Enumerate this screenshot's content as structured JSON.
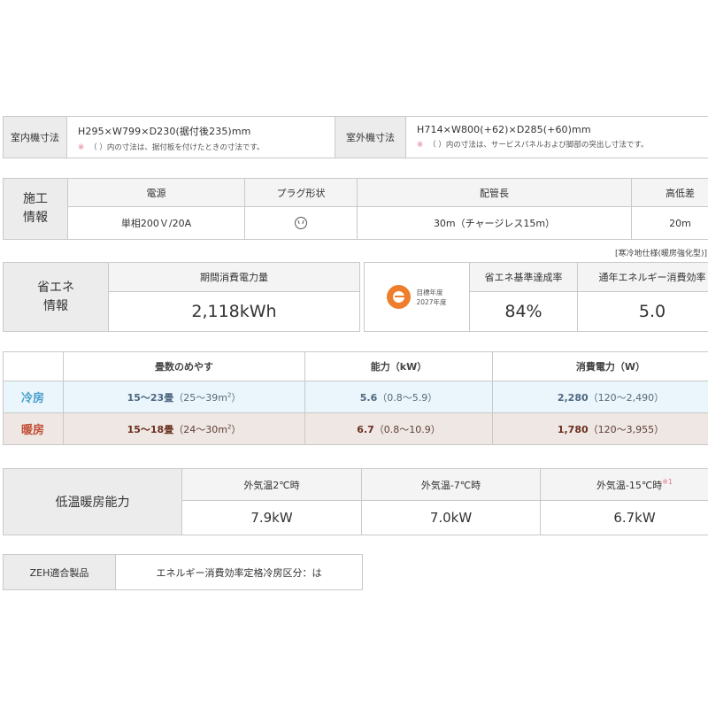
{
  "dimensions": {
    "indoor_label": "室内機寸法",
    "indoor_value": "H295×W799×D230(据付後235)mm",
    "indoor_note_mark": "※",
    "indoor_note": "（ ）内の寸法は、据付板を付けたときの寸法です。",
    "outdoor_label": "室外機寸法",
    "outdoor_value": "H714×W800(+62)×D285(+60)mm",
    "outdoor_note_mark": "※",
    "outdoor_note": "（ ）内の寸法は、サービスパネルおよび脚部の突出し寸法です。"
  },
  "construction": {
    "label_line1": "施工",
    "label_line2": "情報",
    "headers": [
      "電源",
      "プラグ形状",
      "配管長",
      "高低差"
    ],
    "power": "単相200Ｖ/20A",
    "plug_icon": "plug-outlet-icon",
    "pipe_length": "30m（チャージレス15m）",
    "height_diff": "20m"
  },
  "cold_region_note": "[寒冷地仕様(暖房強化型)]",
  "energy": {
    "label_line1": "省エネ",
    "label_line2": "情報",
    "annual_power_label": "期間消費電力量",
    "annual_power_value": "2,118kWh",
    "target_line1": "目標年度",
    "target_line2": "2027年度",
    "achievement_label": "省エネ基準達成率",
    "achievement_value": "84%",
    "apf_label": "通年エネルギー消費効率",
    "apf_value": "5.0",
    "accent_color": "#ee7d2c"
  },
  "capacity": {
    "headers": [
      "畳数のめやす",
      "能力（kW）",
      "消費電力（W）"
    ],
    "cooling": {
      "mode": "冷房",
      "tatami_main": "15～23畳",
      "tatami_sub": "（25～39m",
      "tatami_close": "）",
      "kw_main": "5.6",
      "kw_sub": "（0.8～5.9）",
      "w_main": "2,280",
      "w_sub": "（120～2,490）",
      "color": "#4a9fca"
    },
    "heating": {
      "mode": "暖房",
      "tatami_main": "15～18畳",
      "tatami_sub": "（24～30m",
      "tatami_close": "）",
      "kw_main": "6.7",
      "kw_sub": "（0.8～10.9）",
      "w_main": "1,780",
      "w_sub": "（120～3,955）",
      "color": "#c04d35"
    },
    "sup": "2"
  },
  "low_temp": {
    "label": "低温暖房能力",
    "headers": [
      "外気温2℃時",
      "外気温-7℃時",
      "外気温-15℃時"
    ],
    "ref_mark": "※1",
    "values": [
      "7.9kW",
      "7.0kW",
      "6.7kW"
    ]
  },
  "zeh": {
    "label": "ZEH適合製品",
    "value": "エネルギー消費効率定格冷房区分：は"
  }
}
